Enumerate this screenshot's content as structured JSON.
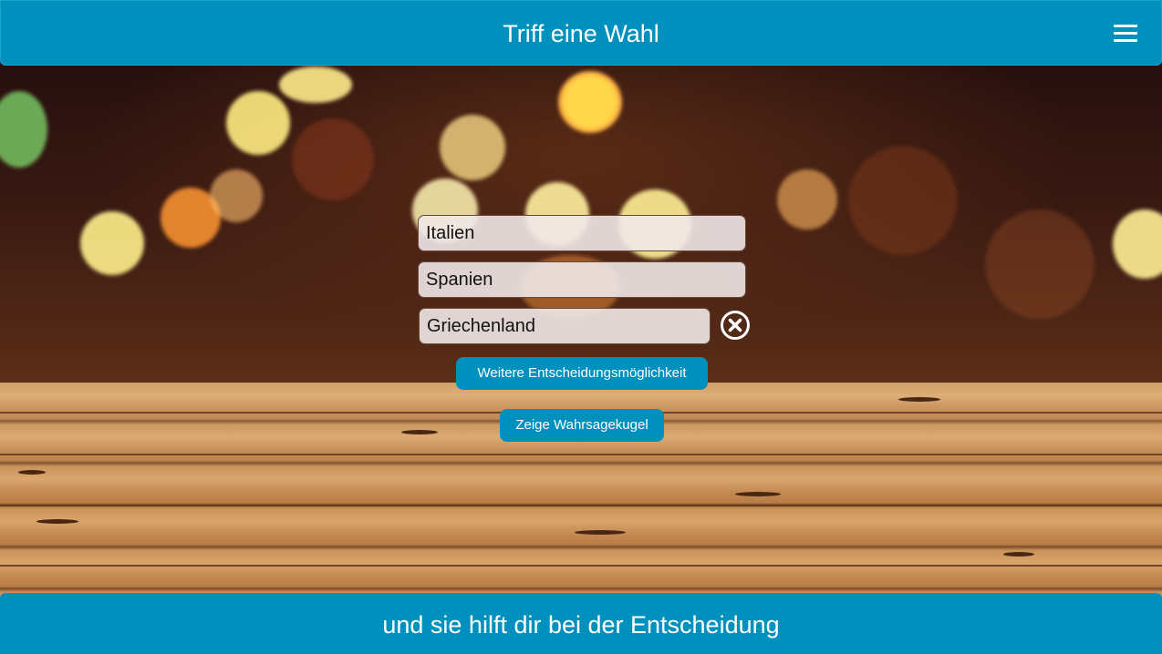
{
  "header": {
    "title": "Triff eine Wahl",
    "menu_icon": "hamburger-menu-icon"
  },
  "options": [
    {
      "value": "Italien"
    },
    {
      "value": "Spanien"
    },
    {
      "value": "Griechenland"
    }
  ],
  "remove_icon": "close-circle-icon",
  "buttons": {
    "add_option_label": "Weitere Entscheidungsmöglichkeit",
    "show_crystal_ball_label": "Zeige Wahrsagekugel"
  },
  "footer": {
    "text": "und sie hilft dir bei der Entscheidung"
  },
  "colors": {
    "accent": "#0090bd",
    "text_on_accent": "#ffffff"
  }
}
